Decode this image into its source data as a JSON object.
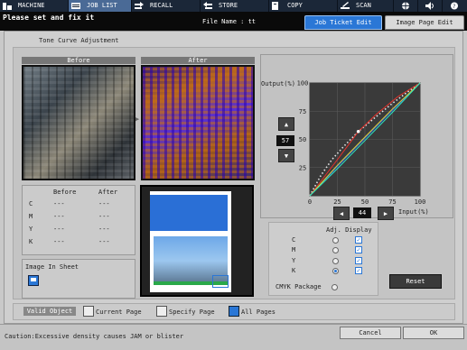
{
  "topbar": {
    "items": [
      {
        "label": "MACHINE",
        "icon": "machine-icon"
      },
      {
        "label": "JOB LIST",
        "icon": "job-list-icon"
      },
      {
        "label": "RECALL",
        "icon": "recall-icon"
      },
      {
        "label": "STORE",
        "icon": "store-icon"
      },
      {
        "label": "COPY",
        "icon": "copy-icon"
      },
      {
        "label": "SCAN",
        "icon": "scan-icon"
      },
      {
        "label": "",
        "icon": "globe-icon"
      },
      {
        "label": "",
        "icon": "speaker-icon"
      },
      {
        "label": "",
        "icon": "help-icon"
      }
    ]
  },
  "status": {
    "message": "Please set and fix it",
    "file_name": "File Name : tt"
  },
  "tabs": {
    "job_ticket_edit": "Job Ticket Edit",
    "image_page_edit": "Image Page Edit"
  },
  "dialog": {
    "title": "Tone Curve Adjustment",
    "before": "Before",
    "after": "After"
  },
  "cmyk_table": {
    "header_before": "Before",
    "header_after": "After",
    "rows": [
      {
        "ch": "C",
        "before": "---",
        "after": "---"
      },
      {
        "ch": "M",
        "before": "---",
        "after": "---"
      },
      {
        "ch": "Y",
        "before": "---",
        "after": "---"
      },
      {
        "ch": "K",
        "before": "---",
        "after": "---"
      }
    ]
  },
  "image_in_sheet": "Image In Sheet",
  "chart_data": {
    "type": "line",
    "ylabel": "Output(%)",
    "xlabel": "Input(%)",
    "xlim": [
      0,
      100
    ],
    "ylim": [
      0,
      100
    ],
    "xticks": [
      "0",
      "25",
      "50",
      "75",
      "100"
    ],
    "yticks": [
      "0",
      "25",
      "50",
      "75",
      "100"
    ],
    "grid": true,
    "series": [
      {
        "color": "#e8e8e8",
        "points": [
          [
            0,
            0
          ],
          [
            10,
            18
          ],
          [
            20,
            32
          ],
          [
            30,
            43
          ],
          [
            44,
            57
          ],
          [
            60,
            70
          ],
          [
            75,
            82
          ],
          [
            90,
            93
          ],
          [
            100,
            100
          ]
        ]
      },
      {
        "color": "#e8312a",
        "points": [
          [
            0,
            0
          ],
          [
            25,
            32
          ],
          [
            44,
            57
          ],
          [
            60,
            72
          ],
          [
            80,
            88
          ],
          [
            100,
            100
          ]
        ]
      },
      {
        "color": "#2a5de8",
        "points": [
          [
            0,
            0
          ],
          [
            25,
            26
          ],
          [
            50,
            51
          ],
          [
            75,
            76
          ],
          [
            100,
            100
          ]
        ]
      },
      {
        "color": "#e8d42a",
        "points": [
          [
            0,
            0
          ],
          [
            25,
            27
          ],
          [
            50,
            52
          ],
          [
            75,
            77
          ],
          [
            100,
            100
          ]
        ]
      },
      {
        "color": "#2ae8c4",
        "points": [
          [
            0,
            0
          ],
          [
            25,
            24
          ],
          [
            50,
            49
          ],
          [
            75,
            74
          ],
          [
            100,
            100
          ]
        ]
      }
    ]
  },
  "stepper": {
    "output_value": "57",
    "input_value": "44",
    "input_label": "Input(%)"
  },
  "adj_display": {
    "title": "Adj. Display",
    "rows": [
      {
        "ch": "C",
        "selected": false,
        "checked": true
      },
      {
        "ch": "M",
        "selected": false,
        "checked": true
      },
      {
        "ch": "Y",
        "selected": false,
        "checked": true
      },
      {
        "ch": "K",
        "selected": true,
        "checked": true
      }
    ],
    "cmyk_package": "CMYK Package",
    "check_mark": "✓"
  },
  "reset_label": "Reset",
  "valid_object": {
    "label": "Valid Object",
    "current_page": "Current Page",
    "specify_page": "Specify Page",
    "all_pages": "All Pages"
  },
  "footer": {
    "caution": "Caution:Excessive density causes JAM or blister",
    "cancel": "Cancel",
    "ok": "OK"
  },
  "colors": {
    "accent": "#2a77d6",
    "topbar": "#1b2738",
    "active_tab": "#4a6a96"
  }
}
